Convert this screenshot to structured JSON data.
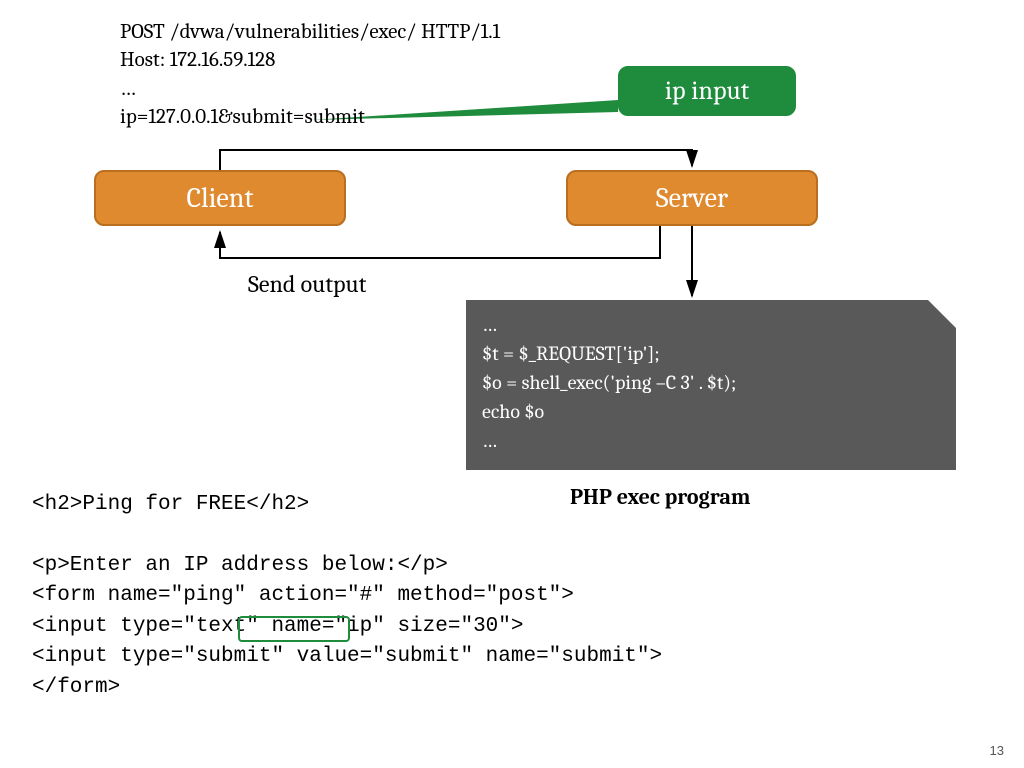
{
  "http": {
    "line1": "POST /dvwa/vulnerabilities/exec/ HTTP/1.1",
    "line2": "Host: 172.16.59.128",
    "line3": "…",
    "line4": "ip=127.0.0.1&submit=submit"
  },
  "callout": {
    "label": "ip input"
  },
  "nodes": {
    "client": "Client",
    "server": "Server"
  },
  "send_label": "Send output",
  "php_code": {
    "l1": " …",
    "l2": " $t = $_REQUEST['ip'];",
    "l3": "$o = shell_exec('ping –C 3' . $t);",
    "l4": "echo $o",
    "l5": " …"
  },
  "php_label": "PHP exec program",
  "html_code": {
    "l1": "<h2>Ping for FREE</h2>",
    "l2": "",
    "l3": "<p>Enter an IP address below:</p>",
    "l4": "<form name=\"ping\" action=\"#\" method=\"post\">",
    "l5": "<input type=\"text\" name=\"ip\" size=\"30\">",
    "l6": "<input type=\"submit\" value=\"submit\" name=\"submit\">",
    "l7": "</form>"
  },
  "page_number": "13"
}
